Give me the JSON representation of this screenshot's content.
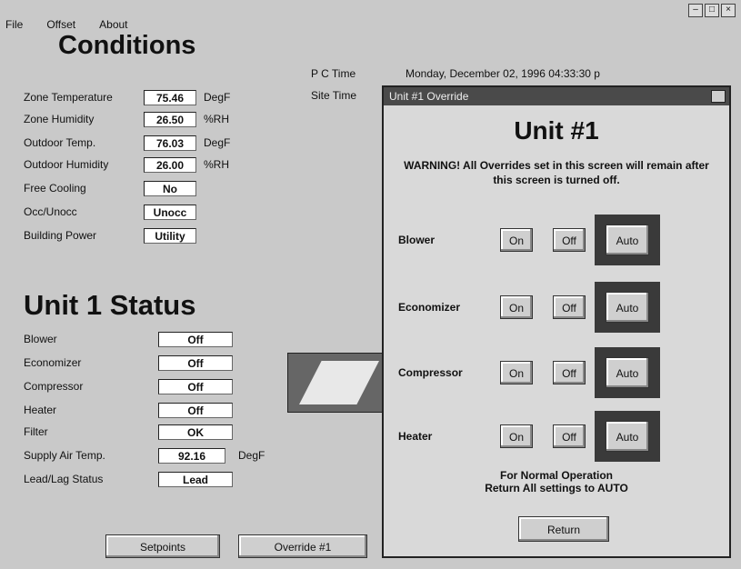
{
  "menu": [
    "File",
    "Offset",
    "About"
  ],
  "conditions": {
    "title": "Conditions",
    "rows": [
      {
        "label": "Zone Temperature",
        "value": "75.46",
        "unit": "DegF"
      },
      {
        "label": "Zone Humidity",
        "value": "26.50",
        "unit": "%RH"
      },
      {
        "label": "Outdoor Temp.",
        "value": "76.03",
        "unit": "DegF"
      },
      {
        "label": "Outdoor Humidity",
        "value": "26.00",
        "unit": "%RH"
      },
      {
        "label": "Free Cooling",
        "value": "No",
        "unit": ""
      },
      {
        "label": "Occ/Unocc",
        "value": "Unocc",
        "unit": ""
      },
      {
        "label": "Building Power",
        "value": "Utility",
        "unit": ""
      }
    ]
  },
  "status": {
    "title": "Unit 1 Status",
    "rows": [
      {
        "label": "Blower",
        "value": "Off",
        "unit": ""
      },
      {
        "label": "Economizer",
        "value": "Off",
        "unit": ""
      },
      {
        "label": "Compressor",
        "value": "Off",
        "unit": ""
      },
      {
        "label": "Heater",
        "value": "Off",
        "unit": ""
      },
      {
        "label": "Filter",
        "value": "OK",
        "unit": ""
      },
      {
        "label": "Supply Air Temp.",
        "value": "92.16",
        "unit": "DegF"
      },
      {
        "label": "Lead/Lag Status",
        "value": "Lead",
        "unit": ""
      }
    ]
  },
  "times": {
    "pc_label": "P C Time",
    "pc_value": "Monday, December 02, 1996  04:33:30 p",
    "site_label": "Site Time"
  },
  "buttons": {
    "setpoints": "Setpoints",
    "override": "Override #1"
  },
  "dialog": {
    "title": "Unit #1 Override",
    "heading": "Unit #1",
    "warning": "WARNING! All Overrides set in this screen will remain after this screen is turned off.",
    "rows": [
      {
        "name": "Blower",
        "on": "On",
        "off": "Off",
        "auto": "Auto"
      },
      {
        "name": "Economizer",
        "on": "On",
        "off": "Off",
        "auto": "Auto"
      },
      {
        "name": "Compressor",
        "on": "On",
        "off": "Off",
        "auto": "Auto"
      },
      {
        "name": "Heater",
        "on": "On",
        "off": "Off",
        "auto": "Auto"
      }
    ],
    "note_line1": "For Normal Operation",
    "note_line2": "Return All settings to AUTO",
    "return_label": "Return"
  }
}
